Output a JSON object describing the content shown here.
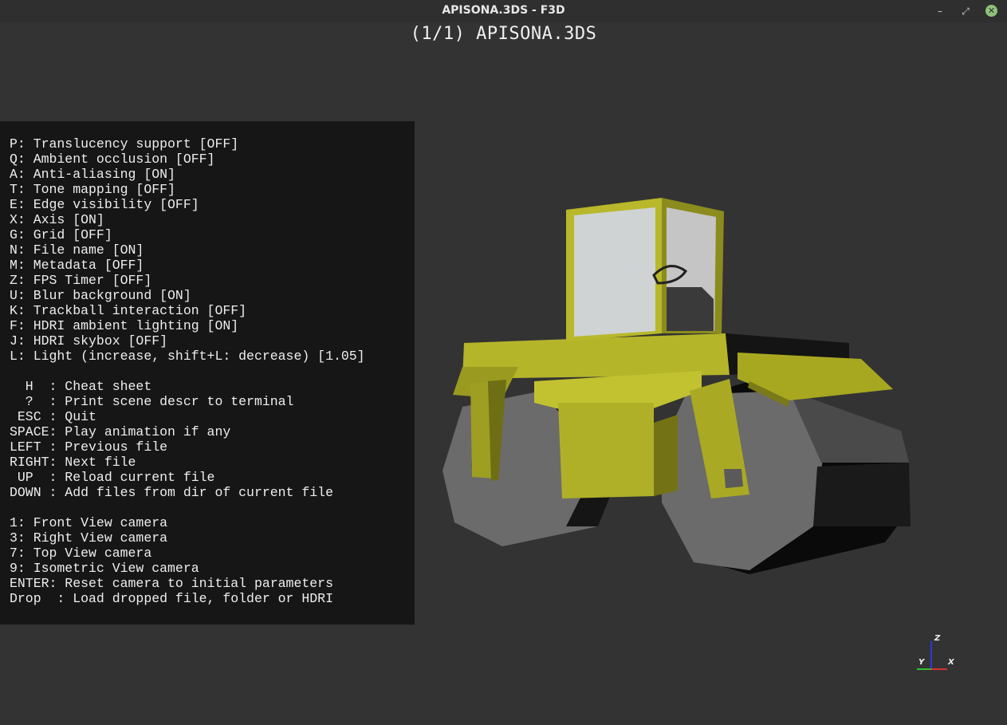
{
  "window": {
    "title": "APISONA.3DS - F3D",
    "controls": {
      "minimize": "–",
      "maximize": "⤢",
      "close": "✕"
    }
  },
  "file_label": "(1/1) APISONA.3DS",
  "cheatsheet": {
    "lines": [
      "P: Translucency support [OFF]",
      "Q: Ambient occlusion [OFF]",
      "A: Anti-aliasing [ON]",
      "T: Tone mapping [OFF]",
      "E: Edge visibility [OFF]",
      "X: Axis [ON]",
      "G: Grid [OFF]",
      "N: File name [ON]",
      "M: Metadata [OFF]",
      "Z: FPS Timer [OFF]",
      "U: Blur background [ON]",
      "K: Trackball interaction [OFF]",
      "F: HDRI ambient lighting [ON]",
      "J: HDRI skybox [OFF]",
      "L: Light (increase, shift+L: decrease) [1.05]",
      "",
      "  H  : Cheat sheet",
      "  ?  : Print scene descr to terminal",
      " ESC : Quit",
      "SPACE: Play animation if any",
      "LEFT : Previous file",
      "RIGHT: Next file",
      " UP  : Reload current file",
      "DOWN : Add files from dir of current file",
      "",
      "1: Front View camera",
      "3: Right View camera",
      "7: Top View camera",
      "9: Isometric View camera",
      "ENTER: Reset camera to initial parameters",
      "Drop  : Load dropped file, folder or HDRI"
    ]
  },
  "axes": {
    "z": "Z",
    "y": "Y",
    "x": "X"
  },
  "colors": {
    "background": "#333333",
    "model_yellow": "#b8b82a",
    "wheel_gray": "#6a6a6a"
  }
}
